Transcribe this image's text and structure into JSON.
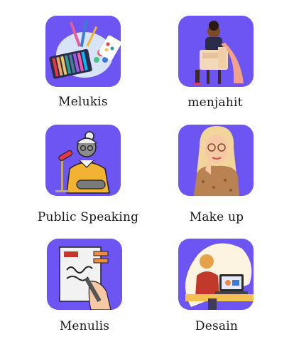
{
  "hobbies": [
    {
      "label": "Melukis",
      "icon": "painting-palette-icon"
    },
    {
      "label": "menjahit",
      "icon": "sewing-machine-icon"
    },
    {
      "label": "Public Speaking",
      "icon": "public-speaking-icon"
    },
    {
      "label": "Make up",
      "icon": "makeup-woman-icon"
    },
    {
      "label": "Menulis",
      "icon": "writing-icon"
    },
    {
      "label": "Desain",
      "icon": "design-laptop-icon"
    }
  ],
  "colors": {
    "tile": "#6c55f2",
    "text": "#1a1a1a"
  }
}
